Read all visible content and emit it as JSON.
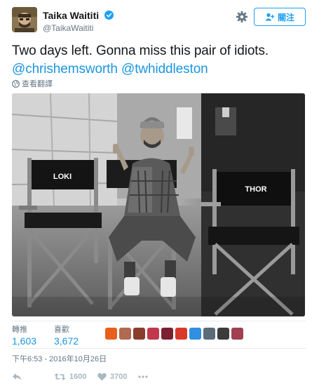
{
  "user": {
    "display_name": "Taika Waititi",
    "handle": "@TaikaWaititi",
    "avatar_icon": "user-avatar",
    "verified_color": "#1da1f2"
  },
  "header": {
    "settings_icon": "gear-icon",
    "follow_label": "關注"
  },
  "tweet": {
    "text": "Two days left. Gonna miss this pair of idiots.",
    "mentions": [
      "@chrishemsworth",
      "@twhiddleston"
    ],
    "translate_label": "查看翻譯"
  },
  "photo": {
    "chair_left": "LOKI",
    "chair_right": "THOR"
  },
  "stats": {
    "retweets_label": "轉推",
    "retweets_value": "1,603",
    "likes_label": "喜歡",
    "likes_value": "3,672"
  },
  "timestamp": "下午6:53 - 2016年10月26日",
  "actions": {
    "reply_icon": "reply-icon",
    "retweet_icon": "retweet-icon",
    "retweet_count": "1600",
    "like_icon": "heart-icon",
    "like_count": "3700",
    "more_icon": "more-icon"
  },
  "colors": {
    "link": "#1b95e0",
    "muted": "#657786",
    "action": "#aab8c2"
  }
}
